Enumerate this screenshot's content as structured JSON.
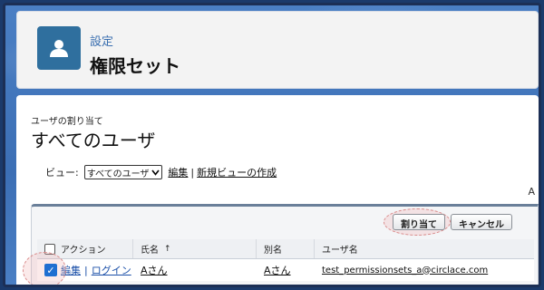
{
  "header": {
    "crumb": "設定",
    "title": "権限セット",
    "icon": "user-icon"
  },
  "main": {
    "section_label": "ユーザの割り当て",
    "section_title": "すべてのユーザ",
    "view_label": "ビュー:",
    "view_selected": "すべてのユーザ",
    "edit_link": "編集",
    "separator": "|",
    "new_view_link": "新規ビューの作成",
    "corner_letter": "A"
  },
  "buttons": {
    "assign": "割り当て",
    "cancel": "キャンセル"
  },
  "table": {
    "headers": {
      "action": "アクション",
      "name": "氏名",
      "sort_indicator": "↑",
      "alias": "別名",
      "username": "ユーザ名"
    },
    "rows": [
      {
        "checked": true,
        "edit": "編集",
        "sep": "|",
        "login": "ログイン",
        "name": "Aさん",
        "alias": "Aさん",
        "username": "test_permissionsets_a@circlace.com"
      }
    ]
  },
  "colors": {
    "accent": "#1f6fd1",
    "header_icon_bg": "#2f6f9e",
    "page_bg": "#3e73b8"
  }
}
